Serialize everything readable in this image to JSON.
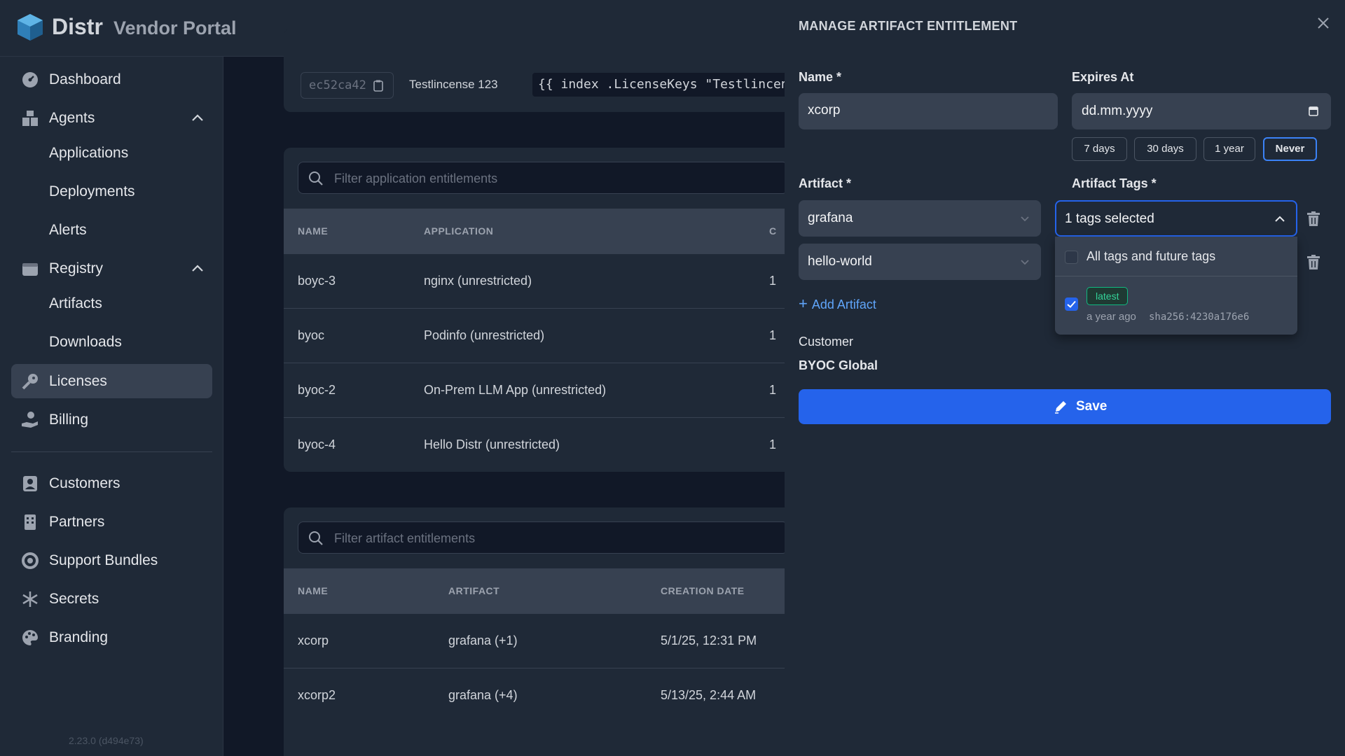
{
  "brand": {
    "name": "Distr",
    "subtitle": "Vendor Portal"
  },
  "sidebar": {
    "items": [
      {
        "label": "Dashboard",
        "icon": "dashboard-icon"
      },
      {
        "label": "Agents",
        "icon": "agents-icon",
        "expanded": true
      },
      {
        "label": "Applications"
      },
      {
        "label": "Deployments"
      },
      {
        "label": "Alerts"
      },
      {
        "label": "Registry",
        "icon": "registry-icon",
        "expanded": true
      },
      {
        "label": "Artifacts"
      },
      {
        "label": "Downloads"
      },
      {
        "label": "Licenses",
        "icon": "key-icon",
        "active": true
      },
      {
        "label": "Billing",
        "icon": "billing-icon"
      },
      {
        "label": "Customers",
        "icon": "customers-icon"
      },
      {
        "label": "Partners",
        "icon": "partners-icon"
      },
      {
        "label": "Support Bundles",
        "icon": "support-icon"
      },
      {
        "label": "Secrets",
        "icon": "asterisk-icon"
      },
      {
        "label": "Branding",
        "icon": "palette-icon"
      }
    ],
    "version": "2.23.0 (d494e73)"
  },
  "license": {
    "id": "ec52ca42",
    "name": "Testlincense 123",
    "code": "{{ index .LicenseKeys \"Testlincens"
  },
  "app_entitlements": {
    "filter_placeholder": "Filter application entitlements",
    "columns": [
      "NAME",
      "APPLICATION",
      "C"
    ],
    "rows": [
      {
        "name": "boyc-3",
        "application": "nginx (unrestricted)",
        "extra": "1"
      },
      {
        "name": "byoc",
        "application": "Podinfo (unrestricted)",
        "extra": "1"
      },
      {
        "name": "byoc-2",
        "application": "On-Prem LLM App (unrestricted)",
        "extra": "1"
      },
      {
        "name": "byoc-4",
        "application": "Hello Distr (unrestricted)",
        "extra": "1"
      }
    ]
  },
  "artifact_entitlements": {
    "filter_placeholder": "Filter artifact entitlements",
    "columns": [
      "NAME",
      "ARTIFACT",
      "CREATION DATE"
    ],
    "rows": [
      {
        "name": "xcorp",
        "artifact": "grafana (+1)",
        "date": "5/1/25, 12:31 PM"
      },
      {
        "name": "xcorp2",
        "artifact": "grafana (+4)",
        "date": "5/13/25, 2:44 AM"
      }
    ]
  },
  "drawer": {
    "title": "MANAGE ARTIFACT ENTITLEMENT",
    "name_label": "Name *",
    "name_value": "xcorp",
    "expires_label": "Expires At",
    "expires_placeholder": "dd.mm.yyyy",
    "quick_options": [
      "7 days",
      "30 days",
      "1 year",
      "Never"
    ],
    "quick_selected": "Never",
    "artifact_label": "Artifact *",
    "artifacts": [
      "grafana",
      "hello-world"
    ],
    "tags_label": "Artifact Tags *",
    "tags_summary": "1 tags selected",
    "tags_menu": {
      "all_label": "All tags and future tags",
      "all_checked": false,
      "tag": {
        "name": "latest",
        "age": "a year ago",
        "digest": "sha256:4230a176e6",
        "checked": true
      }
    },
    "add_artifact": "Add Artifact",
    "customer_label": "Customer",
    "customer_value": "BYOC Global",
    "save_label": "Save"
  },
  "colors": {
    "accent": "#2563eb",
    "sidebar_bg": "#1f2937",
    "page_bg": "#111827",
    "badge_green": "#34d399"
  }
}
